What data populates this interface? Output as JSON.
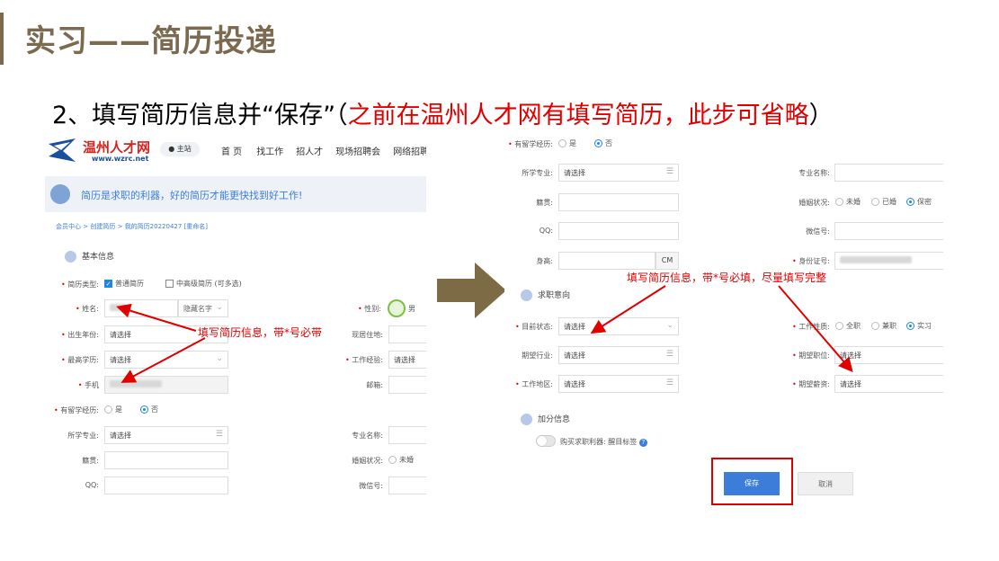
{
  "slide": {
    "title": "实习——简历投递",
    "subtitle_prefix": "2、填写简历信息并“保存”（",
    "subtitle_red": "之前在温州人才网有填写简历，此步可省略",
    "subtitle_suffix": "）"
  },
  "left": {
    "logo_text": "温州人才网",
    "logo_url": "www.wzrc.net",
    "site_badge": "主站",
    "nav": [
      "首 页",
      "找工作",
      "招人才",
      "现场招聘会",
      "网络招聘"
    ],
    "banner_text": "简历是求职的利器，好的简历才能更快找到好工作!",
    "breadcrumb": [
      "会员中心",
      "创建简历",
      "我的简历20220427"
    ],
    "breadcrumb_sep": ">",
    "rename_link": "[重命名]",
    "section_basic": "基本信息",
    "resume_type_label": "简历类型:",
    "resume_type_opt1": "普通简历",
    "resume_type_opt2": "中高级简历",
    "resume_type_hint": "(可多选)",
    "name_label": "姓名:",
    "hide_name": "隐藏名字",
    "gender_label": "性别:",
    "gender_value": "男",
    "birth_label": "出生年份:",
    "birth_value": "请选择",
    "residence_label": "现居住地:",
    "edu_label": "最高学历:",
    "edu_value": "请选择",
    "exp_label": "工作经验:",
    "exp_value": "请选择",
    "phone_label": "手机",
    "email_label": "邮箱:",
    "abroad_label": "有留学经历:",
    "abroad_yes": "是",
    "abroad_no": "否",
    "major_label": "所学专业:",
    "major_value": "请选择",
    "major_name_label": "专业名称:",
    "native_label": "籍贯:",
    "marriage_label": "婚姻状况:",
    "marriage_opt1": "未婚",
    "qq_label": "QQ:",
    "wechat_label": "微信号:",
    "annotation": "填写简历信息，带*号必带"
  },
  "right": {
    "abroad_label": "有留学经历:",
    "abroad_yes": "是",
    "abroad_no": "否",
    "major_label": "所学专业:",
    "major_value": "请选择",
    "major_name_label": "专业名称:",
    "native_label": "籍贯:",
    "marriage_label": "婚姻状况:",
    "marriage_opts": [
      "未婚",
      "已婚",
      "保密"
    ],
    "qq_label": "QQ:",
    "wechat_label": "微信号:",
    "height_label": "身高:",
    "height_unit": "CM",
    "id_label": "身份证号:",
    "section_intent": "求职意向",
    "status_label": "目前状态:",
    "status_value": "请选择",
    "jobtype_label": "工作性质:",
    "jobtype_opts": [
      "全职",
      "兼职",
      "实习"
    ],
    "industry_label": "期望行业:",
    "industry_value": "请选择",
    "position_label": "期望职位:",
    "position_value": "请选择",
    "area_label": "工作地区:",
    "area_value": "请选择",
    "salary_label": "期望薪资:",
    "salary_value": "请选择",
    "section_bonus": "加分信息",
    "buy_label": "购买求职利器:",
    "buy_value": "醒目标签",
    "save_btn": "保存",
    "cancel_btn": "取消",
    "annotation": "填写简历信息，带*号必填，尽量填写完整"
  },
  "colors": {
    "title": "#7b6a4f",
    "accent_red": "#e00000",
    "primary_blue": "#3b7dd8",
    "big_arrow": "#7d6b45"
  }
}
